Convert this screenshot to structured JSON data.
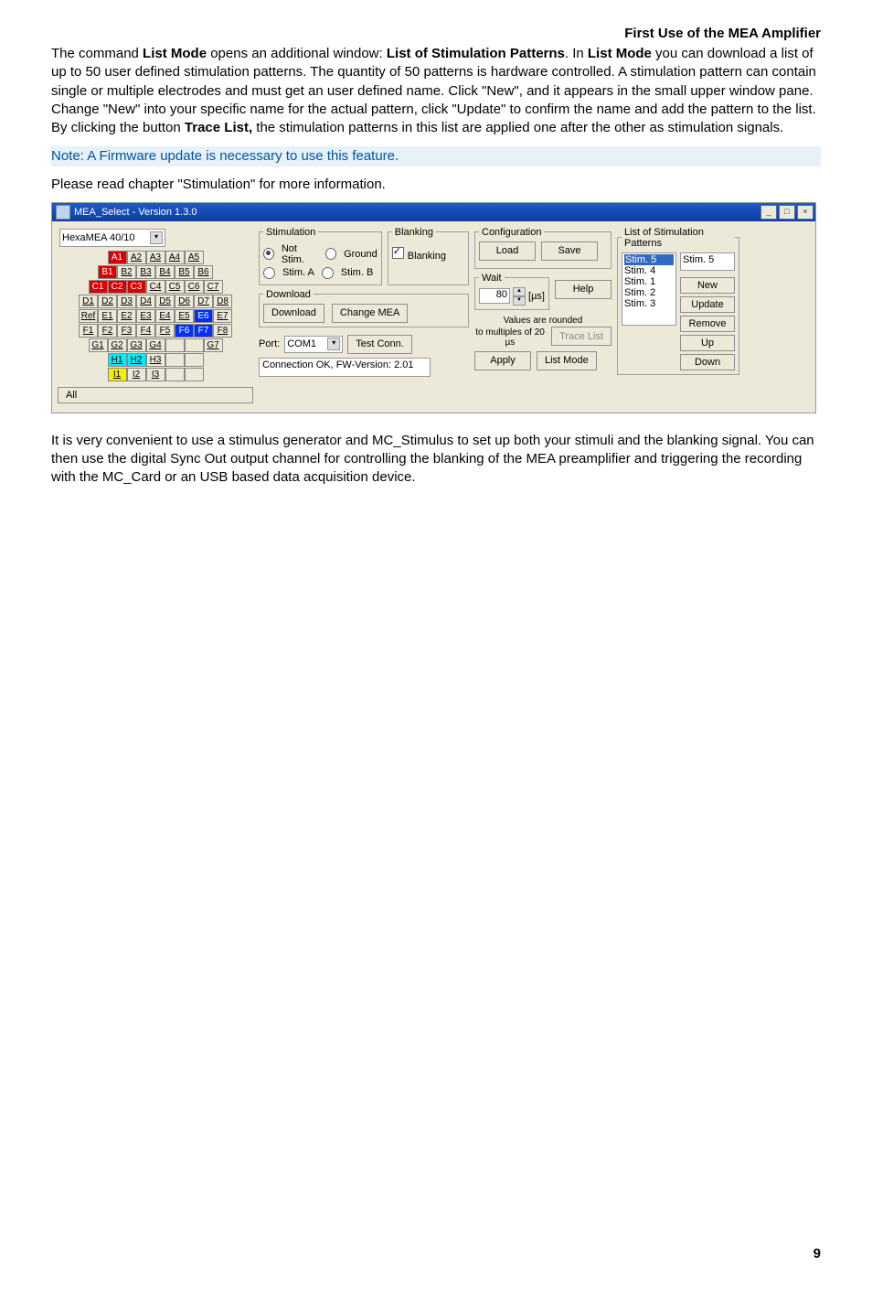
{
  "header": {
    "title": "First Use of the MEA Amplifier"
  },
  "p1": {
    "t1": "The command ",
    "b1": "List Mode",
    "t2": " opens an additional window: ",
    "b2": "List of Stimulation Patterns",
    "t3": ". In ",
    "b3": "List Mode",
    "t4": " you can download a list of up to 50 user defined stimulation patterns. The quantity of 50 patterns is hardware controlled. A stimulation pattern can contain single or multiple electrodes and must get an user defined name. Click \"New\", and it appears in the small upper window pane. Change \"New\" into your specific name for the actual pattern, click \"Update\" to confirm the name and add the pattern to the list. By clicking the button ",
    "b4": "Trace List,",
    "t5": " the stimulation patterns in this list are applied one after the other as stimulation signals."
  },
  "note": "Note: A Firmware update is necessary to use this feature.",
  "p2": "Please read chapter \"Stimulation\" for more information.",
  "win": {
    "title": "MEA_Select  -  Version 1.3.0",
    "minimize": "_",
    "maximize": "□",
    "close": "×",
    "mea_name": "HexaMEA 40/10",
    "all_btn": "All",
    "grid": {
      "r1": [
        "A1",
        "A2",
        "A3",
        "A4",
        "A5"
      ],
      "r2": [
        "B1",
        "B2",
        "B3",
        "B4",
        "B5",
        "B6"
      ],
      "r3": [
        "C1",
        "C2",
        "C3",
        "C4",
        "C5",
        "C6",
        "C7"
      ],
      "r4": [
        "D1",
        "D2",
        "D3",
        "D4",
        "D5",
        "D6",
        "D7",
        "D8"
      ],
      "r5": [
        "Ref",
        "E1",
        "E2",
        "E3",
        "E4",
        "E5",
        "E6",
        "E7"
      ],
      "r6": [
        "F1",
        "F2",
        "F3",
        "F4",
        "F5",
        "F6",
        "F7",
        "F8"
      ],
      "r7": [
        "G1",
        "G2",
        "G3",
        "G4",
        "",
        "",
        "G7"
      ],
      "r8": [
        "H1",
        "H2",
        "H3"
      ],
      "r9": [
        "I1",
        "I2",
        "I3"
      ]
    },
    "stim": {
      "legend": "Stimulation",
      "notstim": "Not Stim.",
      "ground": "Ground",
      "stimA": "Stim. A",
      "stimB": "Stim. B"
    },
    "blank": {
      "legend": "Blanking",
      "chk": "Blanking"
    },
    "dl": {
      "legend": "Download",
      "btn": "Download",
      "change": "Change MEA"
    },
    "port_lbl": "Port:",
    "port_val": "COM1",
    "test": "Test Conn.",
    "status": "Connection OK, FW-Version: 2.01",
    "cfg": {
      "legend": "Configuration",
      "load": "Load",
      "save": "Save"
    },
    "wait": {
      "legend": "Wait",
      "value": "80",
      "unit": "[µs]",
      "hint1": "Values are rounded",
      "hint2": "to multiples of 20 µs"
    },
    "help": "Help",
    "trace": "Trace List",
    "apply": "Apply",
    "listmode": "List Mode",
    "patterns": {
      "legend": "List of Stimulation Patterns",
      "items": [
        "Stim. 5",
        "Stim. 4",
        "Stim. 1",
        "Stim. 2",
        "Stim. 3"
      ],
      "selected": "Stim. 5",
      "edit": "Stim. 5",
      "new": "New",
      "update": "Update",
      "remove": "Remove",
      "up": "Up",
      "down": "Down"
    }
  },
  "p3": "It is very convenient to use a stimulus generator and MC_Stimulus to set up both your stimuli and the blanking signal. You can then use the digital Sync Out output channel for controlling the blanking of the MEA preamplifier and triggering the recording with the MC_Card or an USB based data acquisition device.",
  "footer": {
    "page": "9"
  }
}
